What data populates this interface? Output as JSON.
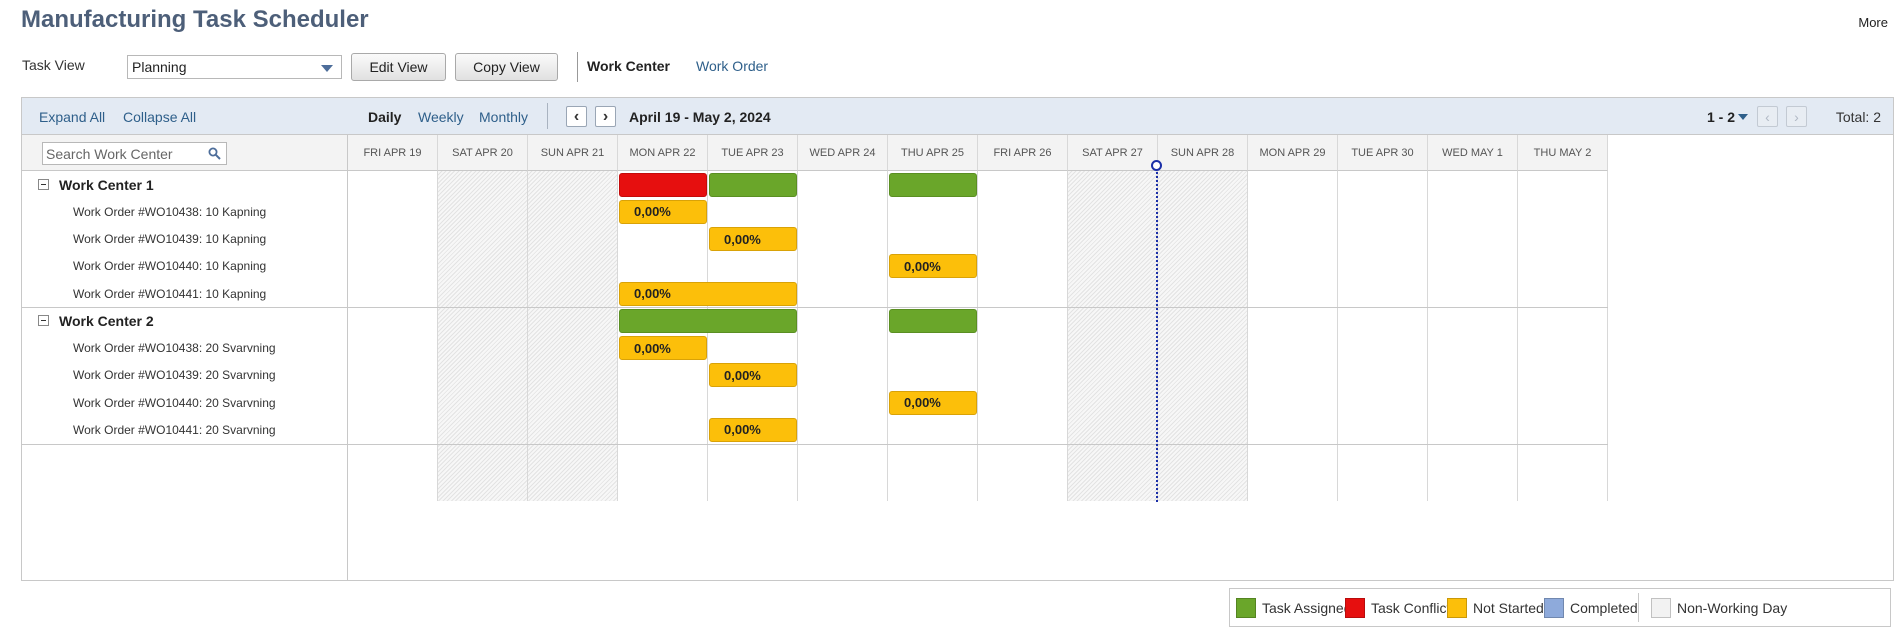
{
  "page": {
    "title": "Manufacturing Task Scheduler",
    "more_label": "More"
  },
  "controls": {
    "task_view_label": "Task View",
    "task_view_value": "Planning",
    "edit_view_label": "Edit View",
    "copy_view_label": "Copy View",
    "tabs": {
      "work_center": "Work Center",
      "work_order": "Work Order"
    }
  },
  "toolbar": {
    "expand_all": "Expand All",
    "collapse_all": "Collapse All",
    "scale_daily": "Daily",
    "scale_weekly": "Weekly",
    "scale_monthly": "Monthly",
    "prev_icon": "chevron-left-icon",
    "next_icon": "chevron-right-icon",
    "date_range": "April 19 - May 2, 2024",
    "pager": "1 - 2",
    "total": "Total: 2"
  },
  "search": {
    "placeholder": "Search Work Center"
  },
  "days": [
    {
      "label": "FRI APR 19",
      "non_working": false
    },
    {
      "label": "SAT APR 20",
      "non_working": true
    },
    {
      "label": "SUN APR 21",
      "non_working": true
    },
    {
      "label": "MON APR 22",
      "non_working": false
    },
    {
      "label": "TUE APR 23",
      "non_working": false
    },
    {
      "label": "WED APR 24",
      "non_working": false
    },
    {
      "label": "THU APR 25",
      "non_working": false
    },
    {
      "label": "FRI APR 26",
      "non_working": false
    },
    {
      "label": "SAT APR 27",
      "non_working": true
    },
    {
      "label": "SUN APR 28",
      "non_working": true
    },
    {
      "label": "MON APR 29",
      "non_working": false
    },
    {
      "label": "TUE APR 30",
      "non_working": false
    },
    {
      "label": "WED MAY 1",
      "non_working": false
    },
    {
      "label": "THU MAY 2",
      "non_working": false
    }
  ],
  "today_day_index": 8.99,
  "work_centers": [
    {
      "name": "Work Center 1",
      "summary_bars": [
        {
          "start": 3,
          "end": 4,
          "status": "conflict"
        },
        {
          "start": 4,
          "end": 5,
          "status": "assigned"
        },
        {
          "start": 6,
          "end": 7,
          "status": "assigned"
        }
      ],
      "orders": [
        {
          "name": "Work Order #WO10438: 10 Kapning",
          "start": 3,
          "end": 4,
          "status": "not_started",
          "progress": "0,00%"
        },
        {
          "name": "Work Order #WO10439: 10 Kapning",
          "start": 4,
          "end": 5,
          "status": "not_started",
          "progress": "0,00%"
        },
        {
          "name": "Work Order #WO10440: 10 Kapning",
          "start": 6,
          "end": 7,
          "status": "not_started",
          "progress": "0,00%"
        },
        {
          "name": "Work Order #WO10441: 10 Kapning",
          "start": 3,
          "end": 5,
          "status": "not_started",
          "progress": "0,00%"
        }
      ]
    },
    {
      "name": "Work Center 2",
      "summary_bars": [
        {
          "start": 3,
          "end": 5,
          "status": "assigned"
        },
        {
          "start": 6,
          "end": 7,
          "status": "assigned"
        }
      ],
      "orders": [
        {
          "name": "Work Order #WO10438: 20 Svarvning",
          "start": 3,
          "end": 4,
          "status": "not_started",
          "progress": "0,00%"
        },
        {
          "name": "Work Order #WO10439: 20 Svarvning",
          "start": 4,
          "end": 5,
          "status": "not_started",
          "progress": "0,00%"
        },
        {
          "name": "Work Order #WO10440: 20 Svarvning",
          "start": 6,
          "end": 7,
          "status": "not_started",
          "progress": "0,00%"
        },
        {
          "name": "Work Order #WO10441: 20 Svarvning",
          "start": 4,
          "end": 5,
          "status": "not_started",
          "progress": "0,00%"
        }
      ]
    }
  ],
  "legend": [
    {
      "label": "Task Assigned",
      "color": "#6aa62a"
    },
    {
      "label": "Task Conflict",
      "color": "#e60f0f"
    },
    {
      "label": "Not Started",
      "color": "#fcbf0a"
    },
    {
      "label": "Completed",
      "color": "#8eaadb"
    },
    {
      "label": "Non-Working Day",
      "color": "#f2f2f2"
    }
  ]
}
